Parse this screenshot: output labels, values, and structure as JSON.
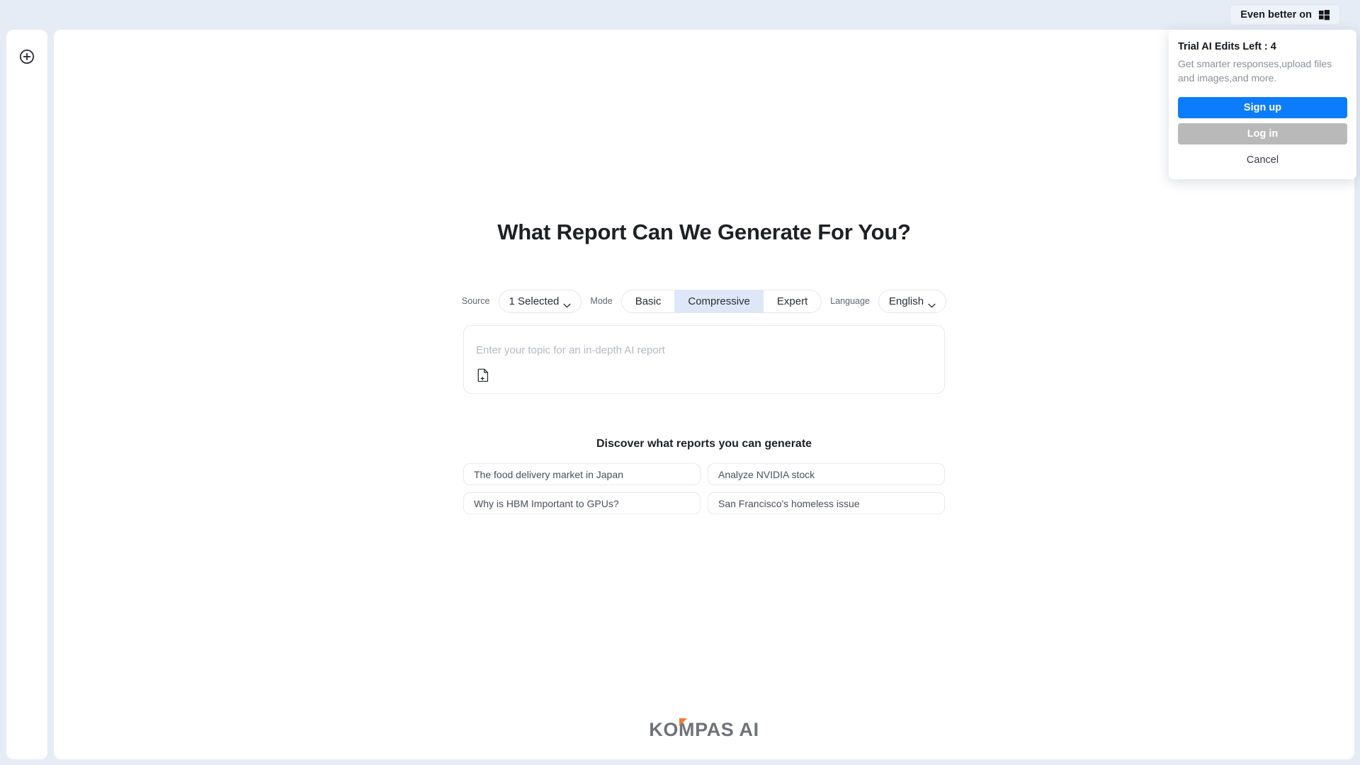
{
  "topbar": {
    "promo_label": "Even better on",
    "promo_icon": "windows-logo-icon"
  },
  "sidebar": {
    "new_chat_icon": "circle-plus-icon"
  },
  "main": {
    "title": "What Report Can We Generate For You?",
    "controls": {
      "source_label": "Source",
      "source_value": "1 Selected",
      "mode_label": "Mode",
      "mode_options": [
        {
          "label": "Basic",
          "selected": false
        },
        {
          "label": "Compressive",
          "selected": true
        },
        {
          "label": "Expert",
          "selected": false
        }
      ],
      "language_label": "Language",
      "language_value": "English"
    },
    "composer": {
      "placeholder": "Enter your topic for an in-depth AI report",
      "attach_icon": "file-plus-icon",
      "value": ""
    },
    "suggestions": {
      "title": "Discover what reports you can generate",
      "items": [
        "The food delivery market in Japan",
        "Analyze NVIDIA stock",
        "Why is HBM Important to GPUs?",
        "San Francisco's homeless issue"
      ]
    },
    "brand": {
      "text_before": "K",
      "text_o": "O",
      "text_after": "MPAS AI",
      "full_text": "KOMPAS AI"
    }
  },
  "trial_popup": {
    "title": "Trial AI Edits Left : 4",
    "description": "Get smarter responses,upload files and images,and more.",
    "signup_label": "Sign up",
    "login_label": "Log in",
    "cancel_label": "Cancel"
  },
  "colors": {
    "page_background": "#e6ecf6",
    "panel": "#ffffff",
    "accent_blue": "#0b7cfb",
    "mode_selected": "#dde7f7",
    "login_gray": "#b9b9b9",
    "brand_gray": "#6f7378",
    "brand_orange": "#f07a35"
  }
}
